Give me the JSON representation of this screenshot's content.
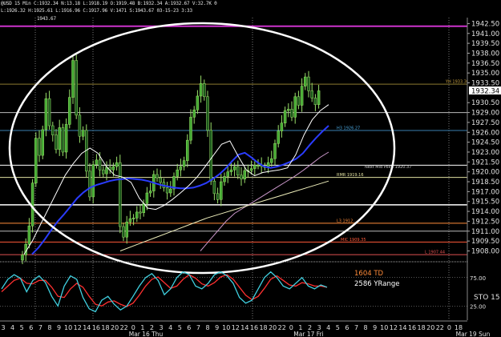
{
  "header": {
    "line1": "@USD 15 Min C:1932.34 N:13.18 L:1918.19 O:1919.48 B:1932.34 A:1932.67 V:32.7K 0",
    "line2": "L:1926.32 H:1925.61 L:1916.96 C:1917.96 V:1471 S:1943.67 03-15-23 3:33",
    "top_label": "1943.67"
  },
  "chart_data": {
    "type": "line",
    "price_axis": {
      "ylim": [
        1906.6,
        1943.4
      ],
      "ticks": [
        1942.5,
        1941.0,
        1939.5,
        1938.0,
        1936.5,
        1935.0,
        1933.5,
        1930.5,
        1929.0,
        1927.5,
        1926.0,
        1924.5,
        1923.0,
        1921.5,
        1920.0,
        1918.5,
        1917.0,
        1915.5,
        1914.0,
        1912.5,
        1911.0,
        1909.5,
        1908.0
      ],
      "tick_labels": [
        "1942.50",
        "1941.00",
        "1939.50",
        "1938.00",
        "1936.50",
        "1935.00",
        "1933.50",
        "1930.50",
        "1929.00",
        "1927.50",
        "1926.00",
        "1924.50",
        "1923.00",
        "1921.50",
        "1920.00",
        "1918.50",
        "1917.00",
        "1915.50",
        "1914.00",
        "1912.50",
        "1911.00",
        "1909.50",
        "1908.00"
      ],
      "last_price": "1932.34"
    },
    "annotations": [
      {
        "text": "YH 1933.30",
        "y": 1933.3,
        "color": "#c8a040"
      },
      {
        "text": "H3 1926.27",
        "y": 1926.27,
        "color": "#4aa8e0"
      },
      {
        "text": "Next Mid Point 1920.37",
        "y": 1920.37,
        "color": "#cccccc"
      },
      {
        "text": "RMR 1919.16",
        "y": 1919.16,
        "color": "#e0e0a0"
      },
      {
        "text": "L3 1912...",
        "y": 1912.2,
        "color": "#ff8c3a"
      },
      {
        "text": "MIC 1909.35",
        "y": 1909.35,
        "color": "#ff5a3a"
      },
      {
        "text": "L 1907.44",
        "y": 1907.44,
        "color": "#e05050"
      }
    ],
    "levels": [
      {
        "y": 1942.1,
        "color": "#cc33cc",
        "width": 2
      },
      {
        "y": 1933.3,
        "color": "#8c7a30",
        "width": 1
      },
      {
        "y": 1929.0,
        "color": "#bbbbbb",
        "width": 1
      },
      {
        "y": 1926.27,
        "color": "#3a80b0",
        "width": 1
      },
      {
        "y": 1921.0,
        "color": "#ffffff",
        "width": 1
      },
      {
        "y": 1919.16,
        "color": "#e0e0a0",
        "width": 1
      },
      {
        "y": 1915.0,
        "color": "#ffffff",
        "width": 1.5
      },
      {
        "y": 1912.2,
        "color": "#ff8c3a",
        "width": 1
      },
      {
        "y": 1911.0,
        "color": "#bbbbbb",
        "width": 1
      },
      {
        "y": 1909.35,
        "color": "#ff5a3a",
        "width": 1
      },
      {
        "y": 1907.44,
        "color": "#e05050",
        "width": 1
      }
    ],
    "candles": [
      1907.4,
      1909.0,
      1911.8,
      1918.3,
      1925.1,
      1922.5,
      1926.4,
      1931.1,
      1927.0,
      1925.6,
      1923.4,
      1926.7,
      1923.0,
      1927.2,
      1931.3,
      1936.9,
      1928.6,
      1925.4,
      1926.3,
      1920.1,
      1916.2,
      1921.1,
      1921.8,
      1920.3,
      1919.7,
      1920.7,
      1920.3,
      1920.8,
      1921.4,
      1911.7,
      1910.1,
      1912.4,
      1912.9,
      1913.0,
      1913.9,
      1913.8,
      1915.2,
      1916.8,
      1917.1,
      1919.6,
      1919.1,
      1918.4,
      1917.6,
      1916.8,
      1917.4,
      1919.3,
      1920.3,
      1920.8,
      1921.7,
      1924.8,
      1928.3,
      1929.4,
      1931.5,
      1933.4,
      1931.4,
      1926.3,
      1918.6,
      1916.7,
      1915.8,
      1918.5,
      1919.3,
      1920.0,
      1920.3,
      1920.8,
      1919.5,
      1918.9,
      1920.2,
      1920.2,
      1920.5,
      1921.0,
      1921.0,
      1920.8,
      1920.8,
      1921.4,
      1922.0,
      1924.3,
      1926.2,
      1927.4,
      1929.3,
      1929.5,
      1928.3,
      1931.4,
      1930.1,
      1933.0,
      1934.4,
      1932.3,
      1931.2,
      1930.2,
      1932.3
    ],
    "moving_averages": [
      {
        "color": "#2a3cff",
        "values": [
          1907.5,
          1908.5,
          1909.8,
          1911.2,
          1912.5,
          1913.6,
          1914.8,
          1916.0,
          1916.9,
          1917.6,
          1918.0,
          1918.3,
          1918.6,
          1918.8,
          1918.9,
          1919.0,
          1918.9,
          1918.8,
          1918.6,
          1918.3,
          1918.0,
          1917.8,
          1917.6,
          1917.5,
          1917.5,
          1917.6,
          1917.9,
          1918.3,
          1918.9,
          1919.6,
          1920.5,
          1921.6,
          1922.6,
          1922.9,
          1922.2,
          1921.4,
          1920.8,
          1920.6,
          1920.8,
          1921.1,
          1921.5,
          1922.0,
          1922.8,
          1924.0,
          1925.1,
          1926.1,
          1927.0
        ]
      },
      {
        "color": "#ffffff",
        "values": [
          1907.5,
          1909.5,
          1912.0,
          1914.5,
          1917.0,
          1919.5,
          1921.3,
          1922.8,
          1923.6,
          1922.8,
          1920.8,
          1919.5,
          1919.2,
          1918.4,
          1916.0,
          1914.5,
          1914.3,
          1914.9,
          1915.8,
          1916.8,
          1917.9,
          1919.2,
          1920.8,
          1922.5,
          1924.2,
          1924.7,
          1922.4,
          1920.3,
          1919.4,
          1919.9,
          1920.1,
          1920.3,
          1920.6,
          1922.6,
          1925.6,
          1927.9,
          1929.3,
          1930.2
        ]
      },
      {
        "color": "#cc99cc",
        "values": [
          1908.0,
          1909.5,
          1911.0,
          1912.5,
          1913.7,
          1914.5,
          1915.3,
          1916.1,
          1916.9,
          1917.7,
          1918.5,
          1919.3,
          1920.2,
          1921.2,
          1922.2,
          1923.0
        ]
      },
      {
        "color": "#eeeebb",
        "values": [
          1908.0,
          1909.0,
          1910.0,
          1911.0,
          1912.0,
          1913.0,
          1913.8,
          1914.6,
          1915.4,
          1916.2,
          1917.0,
          1917.8,
          1918.6
        ]
      }
    ],
    "oscillator": {
      "name": "STO",
      "tick_labels": [
        "75.00",
        "25.00"
      ],
      "texts": [
        "1604 TD",
        "2586 YRange"
      ],
      "k": [
        55,
        72,
        80,
        74,
        50,
        70,
        78,
        66,
        42,
        25,
        60,
        78,
        72,
        40,
        20,
        15,
        35,
        42,
        28,
        18,
        25,
        42,
        60,
        75,
        82,
        70,
        45,
        55,
        75,
        85,
        80,
        60,
        55,
        65,
        80,
        85,
        78,
        65,
        40,
        30,
        35,
        55,
        75,
        85,
        75,
        60,
        55,
        65,
        75,
        60,
        55,
        62,
        58
      ],
      "d": [
        50,
        60,
        70,
        74,
        65,
        64,
        70,
        70,
        58,
        42,
        40,
        55,
        65,
        58,
        42,
        28,
        25,
        32,
        34,
        28,
        24,
        30,
        44,
        60,
        72,
        76,
        66,
        56,
        60,
        72,
        80,
        74,
        64,
        60,
        66,
        76,
        80,
        72,
        58,
        44,
        36,
        42,
        56,
        72,
        78,
        70,
        62,
        60,
        66,
        64,
        60,
        60,
        58
      ]
    },
    "x_tick_labels": [
      "3",
      "4",
      "5",
      "6",
      "7",
      "8",
      "9",
      "10",
      "12",
      "14",
      "16",
      "18",
      "20",
      "22",
      "0",
      "1",
      "2",
      "3",
      "4",
      "5",
      "6",
      "7",
      "8",
      "9",
      "10",
      "12",
      "14",
      "16",
      "18",
      "20",
      "22",
      "0",
      "1",
      "2",
      "3",
      "4",
      "5",
      "6",
      "7",
      "8",
      "9",
      "10",
      "12",
      "14",
      "16",
      "18",
      "20",
      "22",
      "0",
      "18"
    ],
    "date_labels": [
      "Mar 16 Thu",
      "Mar 17 Fri",
      "Mar 19 Sun"
    ]
  }
}
